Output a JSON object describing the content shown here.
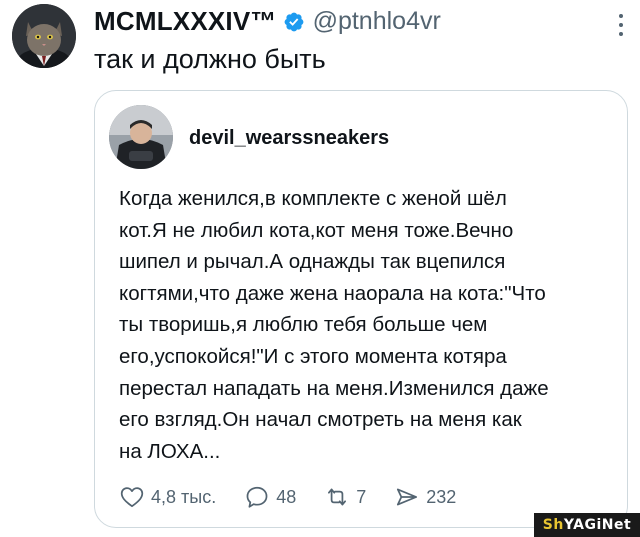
{
  "tweet": {
    "display_name": "MCMLXXXIV™",
    "handle": "@ptnhlo4vr",
    "text": "так и должно быть",
    "verified_icon": "verified-badge-icon",
    "more_icon": "more-dots-icon"
  },
  "quote": {
    "username": "devil_wearssneakers",
    "lines": [
      "Когда женился,в комплекте с женой шёл",
      "кот.Я не любил кота,кот меня тоже.Вечно",
      "шипел и рычал.А однажды так вцепился",
      "когтями,что даже жена наорала на кота:\"Что",
      "ты творишь,я люблю тебя больше чем",
      "его,успокойся!\"И с этого момента котяра",
      "перестал нападать на меня.Изменился даже",
      "его взгляд.Он начал смотреть на меня как",
      "на ЛОХА..."
    ],
    "actions": {
      "likes": "4,8 тыс.",
      "replies": "48",
      "reposts": "7",
      "shares": "232"
    }
  },
  "watermark": {
    "part1": "Sh",
    "part2": "YAGiNet"
  },
  "colors": {
    "accent": "#1d9bf0",
    "text": "#0f1419",
    "secondary": "#536471",
    "border": "#cfd9de"
  }
}
